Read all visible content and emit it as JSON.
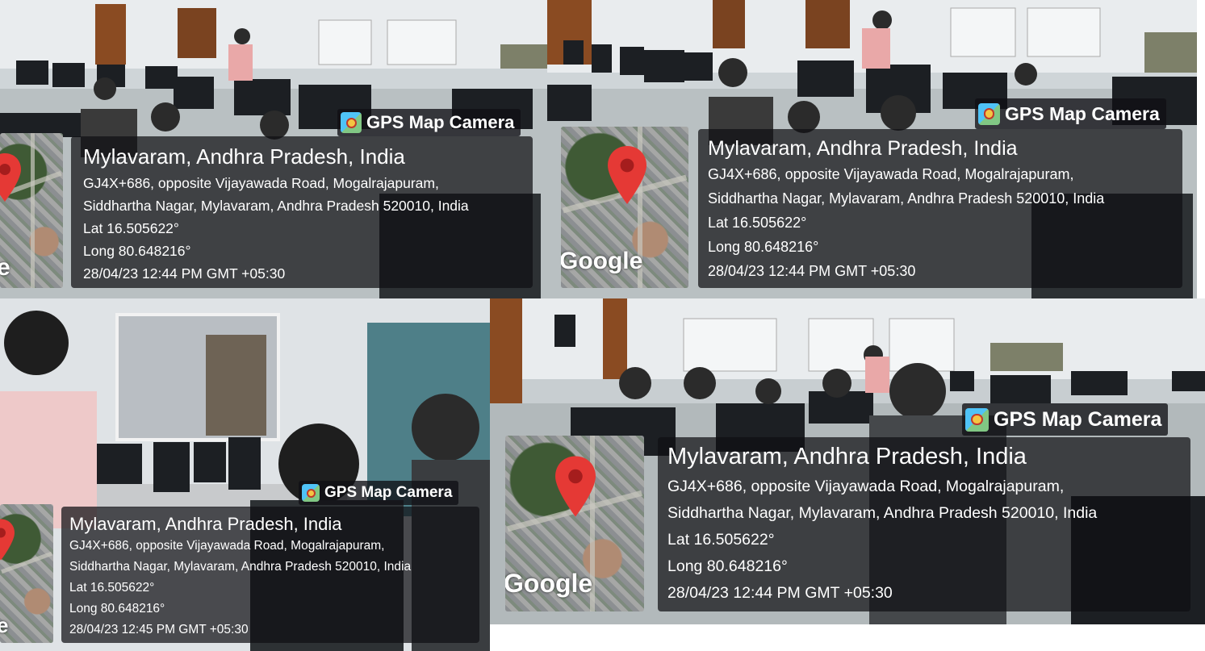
{
  "photos": [
    {
      "camera_label": "GPS Map Camera",
      "map_logo": "e",
      "place": "Mylavaram, Andhra Pradesh, India",
      "address_line1": "GJ4X+686, opposite Vijayawada Road, Mogalrajapuram,",
      "address_line2": "Siddhartha Nagar, Mylavaram, Andhra Pradesh 520010, India",
      "lat": "Lat 16.505622°",
      "long": "Long 80.648216°",
      "datetime": "28/04/23 12:44 PM GMT +05:30"
    },
    {
      "camera_label": "GPS Map Camera",
      "map_logo": "Google",
      "place": "Mylavaram, Andhra Pradesh, India",
      "address_line1": "GJ4X+686, opposite Vijayawada Road, Mogalrajapuram,",
      "address_line2": "Siddhartha Nagar, Mylavaram, Andhra Pradesh 520010, India",
      "lat": "Lat 16.505622°",
      "long": "Long 80.648216°",
      "datetime": "28/04/23 12:44 PM GMT +05:30"
    },
    {
      "camera_label": "GPS Map Camera",
      "map_logo": "e",
      "place": "Mylavaram, Andhra Pradesh, India",
      "address_line1": "GJ4X+686, opposite Vijayawada Road, Mogalrajapuram,",
      "address_line2": "Siddhartha Nagar, Mylavaram, Andhra Pradesh 520010, India",
      "lat": "Lat 16.505622°",
      "long": "Long 80.648216°",
      "datetime": "28/04/23 12:45 PM GMT +05:30"
    },
    {
      "camera_label": "GPS Map Camera",
      "map_logo": "Google",
      "place": "Mylavaram, Andhra Pradesh, India",
      "address_line1": "GJ4X+686, opposite Vijayawada Road, Mogalrajapuram,",
      "address_line2": "Siddhartha Nagar, Mylavaram, Andhra Pradesh 520010, India",
      "lat": "Lat 16.505622°",
      "long": "Long 80.648216°",
      "datetime": "28/04/23 12:44 PM GMT +05:30"
    }
  ],
  "colors": {
    "overlay": "#0f0f14",
    "pin": "#e53935",
    "wall": "#dfe3e6",
    "monitor": "#1c1f23"
  }
}
